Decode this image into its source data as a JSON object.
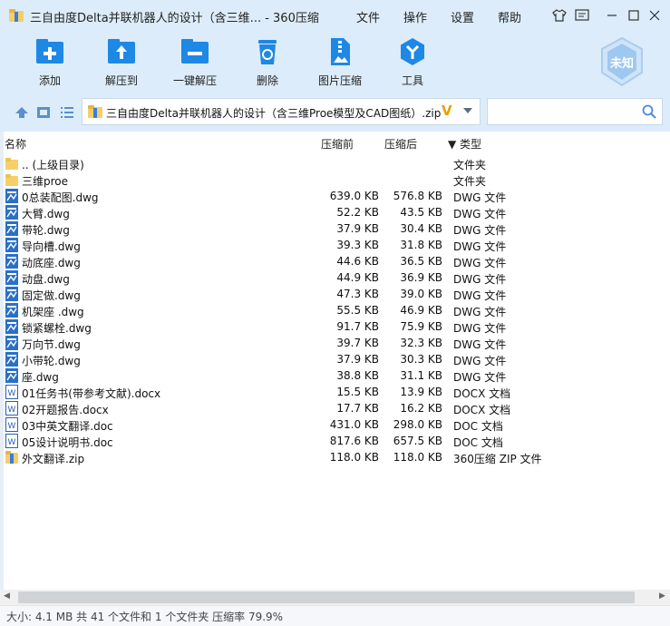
{
  "window": {
    "title": "三自由度Delta并联机器人的设计（含三维... - 360压缩",
    "menu": [
      "文件",
      "操作",
      "设置",
      "帮助"
    ]
  },
  "toolbar": {
    "buttons": [
      {
        "label": "添加",
        "icon": "add-icon"
      },
      {
        "label": "解压到",
        "icon": "extract-to-icon"
      },
      {
        "label": "一键解压",
        "icon": "one-click-extract-icon"
      },
      {
        "label": "删除",
        "icon": "delete-icon"
      },
      {
        "label": "图片压缩",
        "icon": "image-compress-icon"
      },
      {
        "label": "工具",
        "icon": "tools-icon"
      }
    ],
    "badge": "未知"
  },
  "address": {
    "path": "三自由度Delta并联机器人的设计（含三维Proe模型及CAD图纸）.zip",
    "verify_mark": "V"
  },
  "search": {
    "placeholder": ""
  },
  "columns": {
    "name": "名称",
    "size": "压缩前",
    "packed": "压缩后",
    "type": "▼ 类型"
  },
  "files": [
    {
      "name": ".. (上级目录)",
      "size": "",
      "packed": "",
      "type": "文件夹",
      "kind": "folder"
    },
    {
      "name": "三维proe",
      "size": "",
      "packed": "",
      "type": "文件夹",
      "kind": "folder"
    },
    {
      "name": "0总装配图.dwg",
      "size": "639.0 KB",
      "packed": "576.8 KB",
      "type": "DWG 文件",
      "kind": "dwg"
    },
    {
      "name": "大臂.dwg",
      "size": "52.2 KB",
      "packed": "43.5 KB",
      "type": "DWG 文件",
      "kind": "dwg"
    },
    {
      "name": "带轮.dwg",
      "size": "37.9 KB",
      "packed": "30.4 KB",
      "type": "DWG 文件",
      "kind": "dwg"
    },
    {
      "name": "导向槽.dwg",
      "size": "39.3 KB",
      "packed": "31.8 KB",
      "type": "DWG 文件",
      "kind": "dwg"
    },
    {
      "name": "动底座.dwg",
      "size": "44.6 KB",
      "packed": "36.5 KB",
      "type": "DWG 文件",
      "kind": "dwg"
    },
    {
      "name": "动盘.dwg",
      "size": "44.9 KB",
      "packed": "36.9 KB",
      "type": "DWG 文件",
      "kind": "dwg"
    },
    {
      "name": "固定做.dwg",
      "size": "47.3 KB",
      "packed": "39.0 KB",
      "type": "DWG 文件",
      "kind": "dwg"
    },
    {
      "name": "机架座 .dwg",
      "size": "55.5 KB",
      "packed": "46.9 KB",
      "type": "DWG 文件",
      "kind": "dwg"
    },
    {
      "name": "锁紧螺栓.dwg",
      "size": "91.7 KB",
      "packed": "75.9 KB",
      "type": "DWG 文件",
      "kind": "dwg"
    },
    {
      "name": "万向节.dwg",
      "size": "39.7 KB",
      "packed": "32.3 KB",
      "type": "DWG 文件",
      "kind": "dwg"
    },
    {
      "name": "小带轮.dwg",
      "size": "37.9 KB",
      "packed": "30.3 KB",
      "type": "DWG 文件",
      "kind": "dwg"
    },
    {
      "name": "座.dwg",
      "size": "38.8 KB",
      "packed": "31.1 KB",
      "type": "DWG 文件",
      "kind": "dwg"
    },
    {
      "name": "01任务书(带参考文献).docx",
      "size": "15.5 KB",
      "packed": "13.9 KB",
      "type": "DOCX 文档",
      "kind": "doc"
    },
    {
      "name": "02开题报告.docx",
      "size": "17.7 KB",
      "packed": "16.2 KB",
      "type": "DOCX 文档",
      "kind": "doc"
    },
    {
      "name": "03中英文翻译.doc",
      "size": "431.0 KB",
      "packed": "298.0 KB",
      "type": "DOC 文档",
      "kind": "doc"
    },
    {
      "name": "05设计说明书.doc",
      "size": "817.6 KB",
      "packed": "657.5 KB",
      "type": "DOC 文档",
      "kind": "doc"
    },
    {
      "name": "外文翻译.zip",
      "size": "118.0 KB",
      "packed": "118.0 KB",
      "type": "360压缩 ZIP 文件",
      "kind": "zip"
    }
  ],
  "status": "大小: 4.1 MB 共 41 个文件和 1 个文件夹 压缩率 79.9%",
  "colors": {
    "toolbar_bg": "#dcecfa",
    "icon_blue": "#1e88e5",
    "dwg_icon": "#2a6fc9",
    "folder": "#f6cf6b",
    "accent": "#e8a000"
  }
}
